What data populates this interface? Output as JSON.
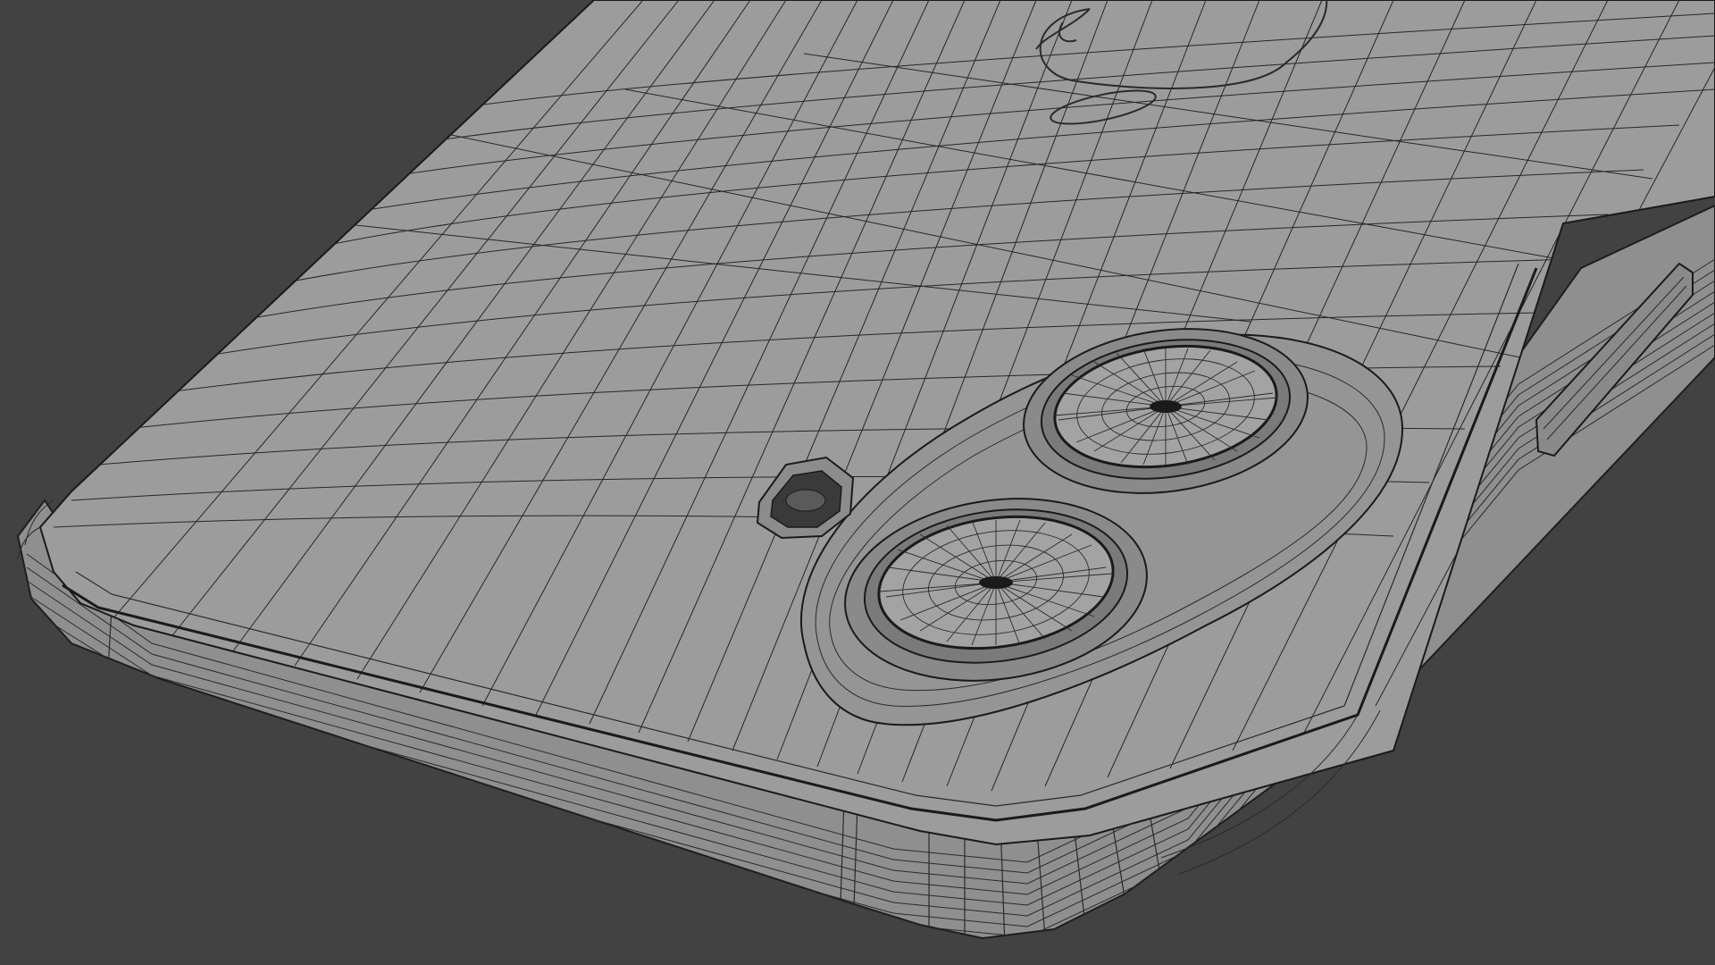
{
  "viewport": {
    "background": "#424242",
    "shading": "solid-wireframe",
    "object": "phone-back-model"
  },
  "colors": {
    "surface": "#9c9c9c",
    "surface_edge": "#8a8a8a",
    "wire": "#1e1e1e",
    "lens_glass": "#a3a3a3",
    "lens_ring": "#7a7a7a"
  },
  "icons": [
    "logo-outline-icon"
  ]
}
